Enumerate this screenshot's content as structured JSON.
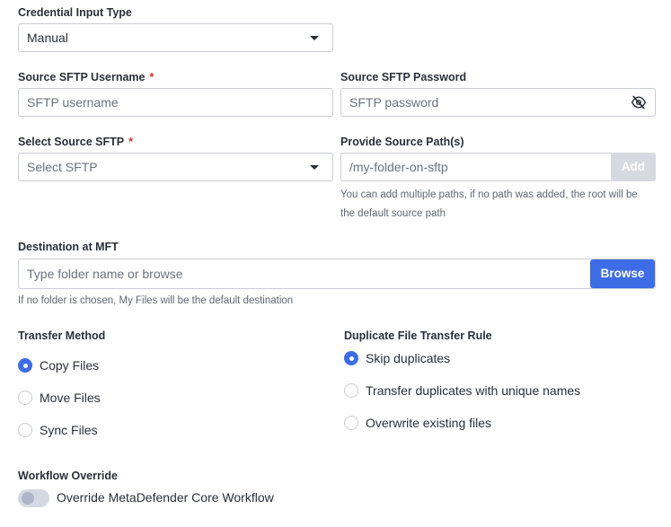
{
  "credential_input_type": {
    "label": "Credential Input Type",
    "selected": "Manual"
  },
  "source_username": {
    "label": "Source SFTP Username",
    "required_mark": "*",
    "placeholder": "SFTP username"
  },
  "source_password": {
    "label": "Source SFTP Password",
    "placeholder": "SFTP password",
    "icon": "eye-slash-icon"
  },
  "select_source": {
    "label": "Select Source SFTP",
    "required_mark": "*",
    "placeholder": "Select SFTP"
  },
  "source_paths": {
    "label": "Provide Source Path(s)",
    "placeholder": "/my-folder-on-sftp",
    "add_label": "Add",
    "help_line1": "You can add multiple paths, if no path was added, the root will be",
    "help_line2": "the default source path"
  },
  "destination": {
    "label": "Destination at MFT",
    "placeholder": "Type folder name or browse",
    "browse_label": "Browse",
    "help": "If no folder is chosen, My Files will be the default destination"
  },
  "transfer_method": {
    "label": "Transfer Method",
    "options": [
      {
        "label": "Copy Files",
        "selected": true
      },
      {
        "label": "Move Files",
        "selected": false
      },
      {
        "label": "Sync Files",
        "selected": false
      }
    ]
  },
  "duplicate_rule": {
    "label": "Duplicate File Transfer Rule",
    "options": [
      {
        "label": "Skip duplicates",
        "selected": true
      },
      {
        "label": "Transfer duplicates with unique names",
        "selected": false
      },
      {
        "label": "Overwrite existing files",
        "selected": false
      }
    ]
  },
  "workflow_override": {
    "label": "Workflow Override",
    "toggle_label": "Override MetaDefender Core Workflow",
    "enabled": false
  },
  "colors": {
    "accent": "#3d6ce7",
    "required": "#d93025",
    "border": "#c9ccd1",
    "disabled_button": "#d6d9e0"
  }
}
